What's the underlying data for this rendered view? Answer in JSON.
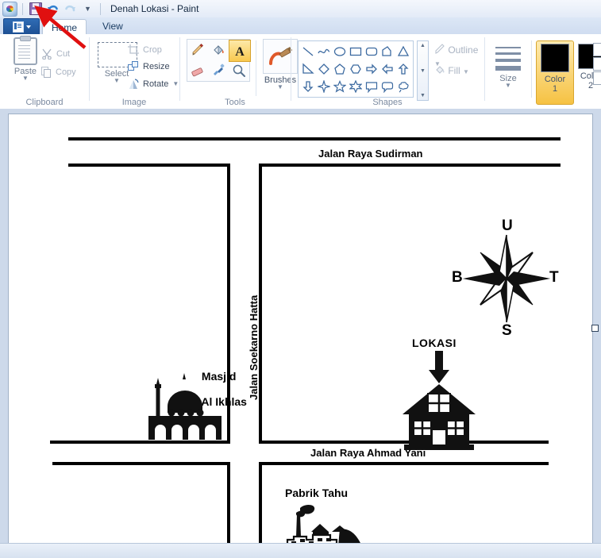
{
  "window": {
    "title": "Denah Lokasi - Paint",
    "quick_access": [
      {
        "name": "paint-app-icon",
        "label": "Paint"
      },
      {
        "name": "save-icon",
        "label": "Save"
      },
      {
        "name": "undo-icon",
        "label": "Undo"
      },
      {
        "name": "redo-icon",
        "label": "Redo"
      },
      {
        "name": "customize-qat-icon",
        "label": "Customize Quick Access Toolbar"
      }
    ]
  },
  "ribbon": {
    "app_menu_label": "",
    "tabs": [
      {
        "label": "Home",
        "active": true
      },
      {
        "label": "View",
        "active": false
      }
    ],
    "groups": {
      "clipboard": {
        "title": "Clipboard",
        "paste": "Paste",
        "cut": "Cut",
        "copy": "Copy"
      },
      "image": {
        "title": "Image",
        "select": "Select",
        "crop": "Crop",
        "resize": "Resize",
        "rotate": "Rotate"
      },
      "tools": {
        "title": "Tools",
        "items": [
          "pencil-tool",
          "fill-tool",
          "text-tool",
          "eraser-tool",
          "color-picker-tool",
          "magnifier-tool"
        ],
        "selected": "text-tool",
        "brushes": "Brushes"
      },
      "shapes": {
        "title": "Shapes",
        "outline": "Outline",
        "fill": "Fill",
        "items": [
          "line",
          "curve",
          "oval",
          "rectangle",
          "rounded-rectangle",
          "polygon",
          "triangle",
          "right-triangle",
          "diamond",
          "pentagon",
          "hexagon",
          "right-arrow",
          "left-arrow",
          "up-arrow",
          "down-arrow",
          "four-point-star",
          "five-point-star",
          "six-point-star",
          "rectangular-callout",
          "rounded-callout",
          "cloud-callout"
        ]
      },
      "colors": {
        "size_label": "Size",
        "color1_label_top": "Color",
        "color1_label_bottom": "1",
        "color2_label_top": "Color",
        "color2_label_bottom": "2",
        "color1_value": "#000000",
        "color2_value": "#000000"
      }
    }
  },
  "canvas": {
    "map": {
      "roads": [
        {
          "name": "jalan-raya-sudirman",
          "label": "Jalan Raya Sudirman"
        },
        {
          "name": "jalan-soekarno-hatta",
          "label": "Jalan Soekarno Hatta"
        },
        {
          "name": "jalan-raya-ahmad-yani",
          "label": "Jalan Raya Ahmad Yani"
        }
      ],
      "landmarks": [
        {
          "name": "masjid-al-ikhlas",
          "label_line1": "Masjid",
          "label_line2": "Al Ikhlas"
        },
        {
          "name": "lokasi-marker",
          "label": "LOKASI"
        },
        {
          "name": "pabrik-tahu",
          "label": "Pabrik Tahu"
        }
      ],
      "compass": {
        "north": "U",
        "east": "T",
        "south": "S",
        "west": "B"
      }
    }
  },
  "annotation": {
    "arrow_color": "#e01010",
    "points_at": "save-icon"
  }
}
